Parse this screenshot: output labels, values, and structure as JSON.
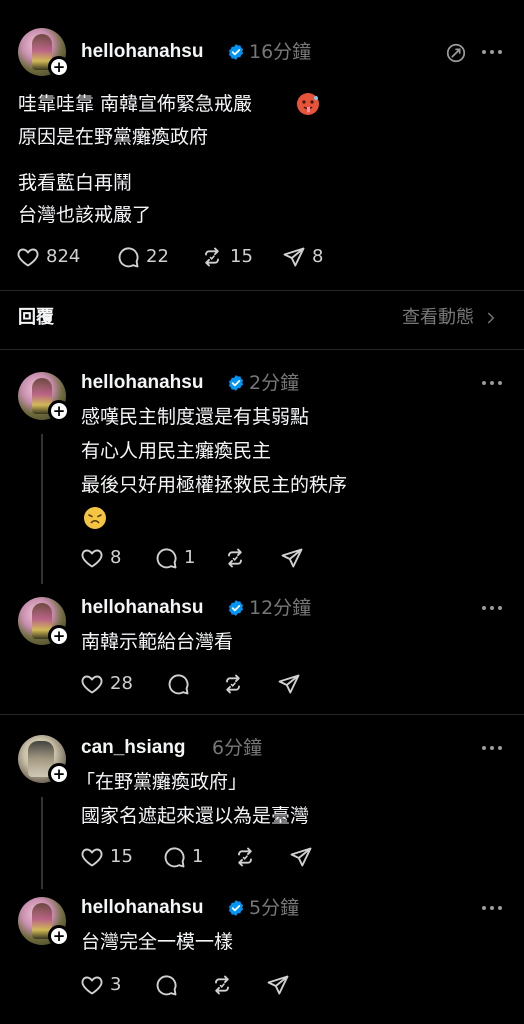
{
  "main_post": {
    "username": "hellohanahsu",
    "time": "16分鐘",
    "lines": [
      "哇靠哇靠 南韓宣佈緊急戒嚴",
      "原因是在野黨癱瘓政府",
      "我看藍白再鬧",
      "台灣也該戒嚴了"
    ],
    "likes": "824",
    "comments": "22",
    "reposts": "15",
    "shares": "8"
  },
  "replies_header": {
    "label": "回覆",
    "activity_link": "查看動態"
  },
  "replies": [
    {
      "username": "hellohanahsu",
      "time": "2分鐘",
      "lines": [
        "感嘆民主制度還是有其弱點",
        "有心人用民主癱瘓民主",
        "最後只好用極權拯救民主的秩序"
      ],
      "likes": "8",
      "comments": "1"
    },
    {
      "username": "hellohanahsu",
      "time": "12分鐘",
      "lines": [
        "南韓示範給台灣看"
      ],
      "likes": "28"
    },
    {
      "username": "can_hsiang",
      "time": "6分鐘",
      "lines": [
        "「在野黨癱瘓政府」",
        "國家名遮起來還以為是臺灣"
      ],
      "likes": "15",
      "comments": "1"
    },
    {
      "username": "hellohanahsu",
      "time": "5分鐘",
      "lines": [
        "台灣完全一模一樣"
      ],
      "likes": "3"
    }
  ],
  "icons": {
    "heart": "heart-icon",
    "comment": "comment-icon",
    "repost": "repost-icon",
    "share": "share-icon",
    "verified": "verified-badge-icon",
    "more": "more-icon",
    "translate": "translate-icon",
    "chevron": "chevron-right-icon"
  },
  "colors": {
    "background": "#000000",
    "text": "#f3f5f7",
    "muted": "#777777",
    "verified": "#0095f6"
  }
}
